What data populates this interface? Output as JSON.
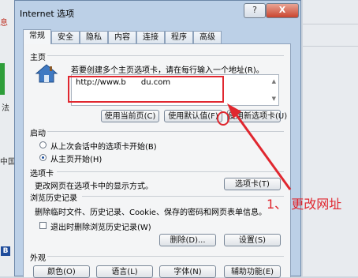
{
  "background": {
    "left_fragment_red": "息",
    "left_fragment_fa": "法",
    "left_fragment_zh": "中国",
    "left_badge": "B"
  },
  "dialog": {
    "title": "Internet 选项",
    "help_button": "?",
    "close_button": "X",
    "tabs": [
      "常规",
      "安全",
      "隐私",
      "内容",
      "连接",
      "程序",
      "高级"
    ],
    "active_tab": "常规"
  },
  "homepage": {
    "section": "主页",
    "hint": "若要创建多个主页选项卡，请在每行输入一个地址(R)。",
    "url_value": "http://www.b      du.com",
    "btn_use_current": "使用当前页(C)",
    "btn_use_default": "使用默认值(F)",
    "btn_use_new_tab": "使用新选项卡(U)"
  },
  "startup": {
    "section": "启动",
    "opt_last_session": "从上次会话中的选项卡开始(B)",
    "opt_homepage": "从主页开始(H)",
    "selected": "opt_homepage"
  },
  "tabs_section": {
    "section": "选项卡",
    "text": "更改网页在选项卡中的显示方式。",
    "button": "选项卡(T)"
  },
  "history": {
    "section": "浏览历史记录",
    "text": "删除临时文件、历史记录、Cookie、保存的密码和网页表单信息。",
    "checkbox_label": "退出时删除浏览历史记录(W)",
    "checkbox_checked": false,
    "btn_delete": "删除(D)...",
    "btn_settings": "设置(S)"
  },
  "appearance": {
    "section": "外观",
    "btn_colors": "颜色(O)",
    "btn_languages": "语言(L)",
    "btn_fonts": "字体(N)",
    "btn_accessibility": "辅助功能(E)"
  },
  "annotation": {
    "text": "1、 更改网址",
    "color": "#e0272f"
  }
}
